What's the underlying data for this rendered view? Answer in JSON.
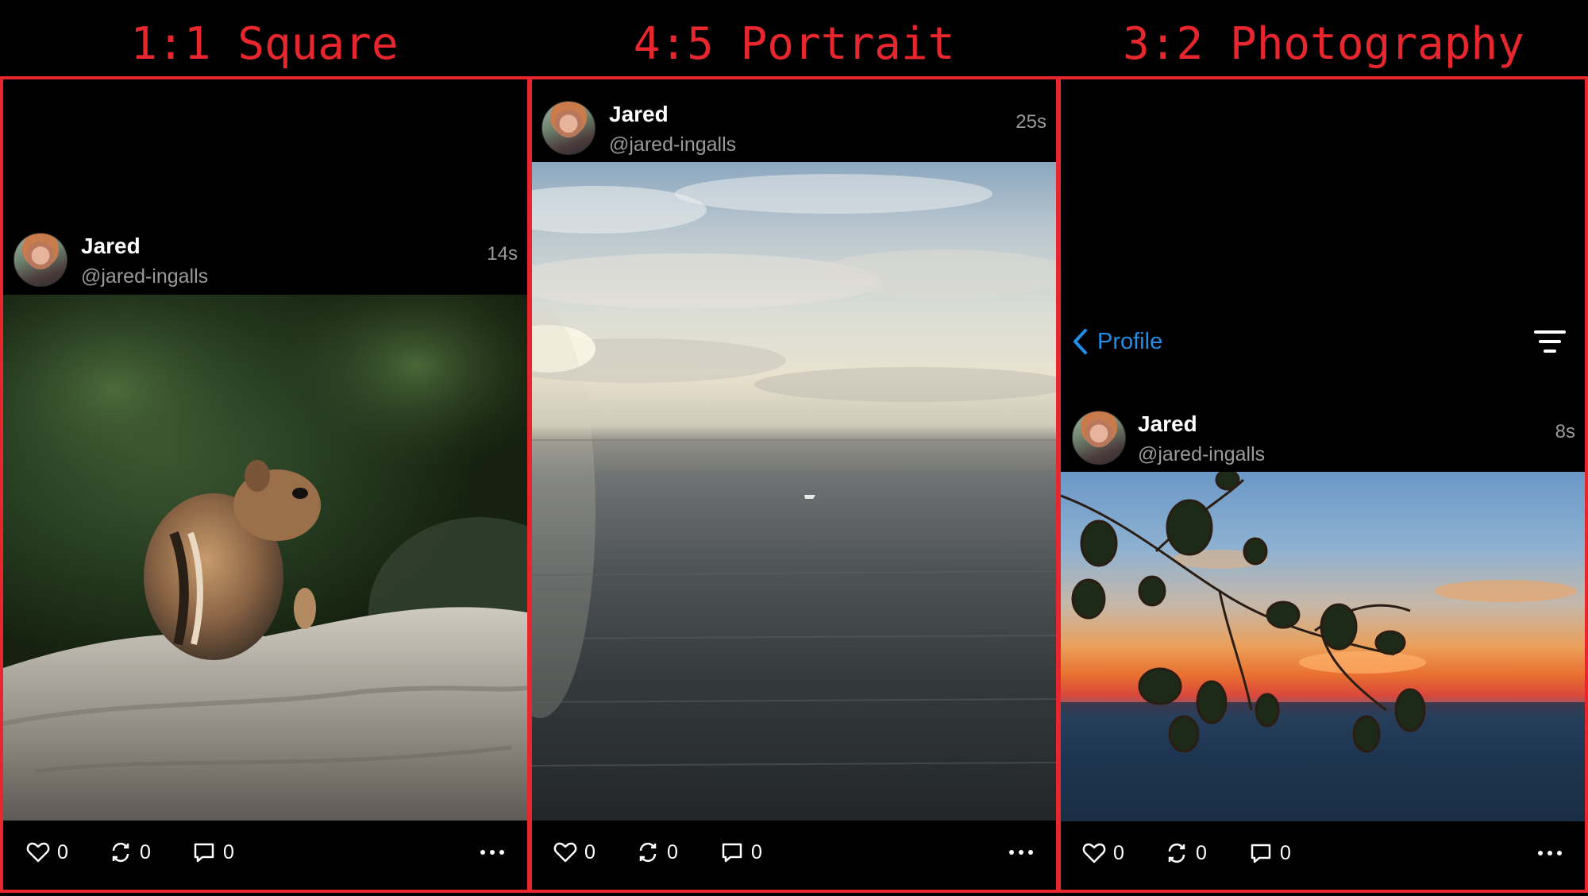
{
  "headings": {
    "square": "1:1 Square",
    "portrait": "4:5 Portrait",
    "photography": "3:2 Photography"
  },
  "nav": {
    "back_label": "Profile",
    "back_icon": "chevron-left-icon",
    "filter_icon": "filter-lines-icon",
    "accent_color": "#1e8ee6"
  },
  "posts": [
    {
      "author_name": "Jared",
      "author_handle": "@jared-ingalls",
      "time": "14s",
      "photo": "chipmunk on rock",
      "likes": "0",
      "reposts": "0",
      "comments": "0"
    },
    {
      "author_name": "Jared",
      "author_handle": "@jared-ingalls",
      "time": "25s",
      "photo": "sea horizon with boat",
      "likes": "0",
      "reposts": "0",
      "comments": "0"
    },
    {
      "author_name": "Jared",
      "author_handle": "@jared-ingalls",
      "time": "8s",
      "photo": "leaves at sunset",
      "likes": "0",
      "reposts": "0",
      "comments": "0"
    }
  ],
  "colors": {
    "frame": "#e8262e",
    "muted_text": "#9a9a9a"
  }
}
